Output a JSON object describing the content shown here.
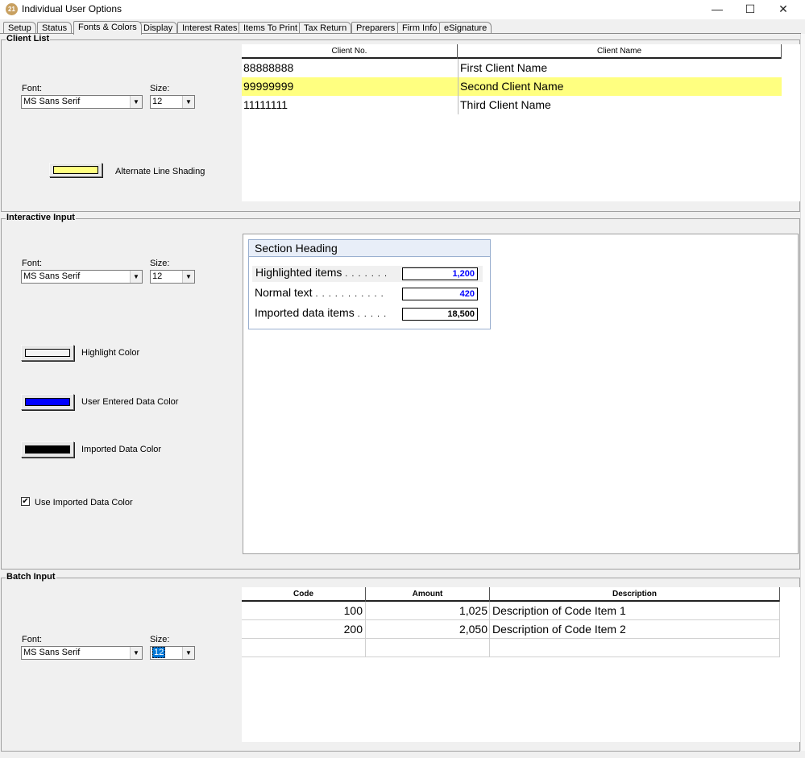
{
  "window": {
    "title": "Individual User Options",
    "icon_text": "21",
    "minimize": "—",
    "maximize": "☐",
    "close": "✕"
  },
  "tabs": [
    {
      "label": "Setup"
    },
    {
      "label": "Status"
    },
    {
      "label": "Fonts & Colors"
    },
    {
      "label": "Display"
    },
    {
      "label": "Interest Rates"
    },
    {
      "label": "Items To Print"
    },
    {
      "label": "Tax Return"
    },
    {
      "label": "Preparers"
    },
    {
      "label": "Firm Info"
    },
    {
      "label": "eSignature"
    }
  ],
  "client_list": {
    "label": "Client List",
    "font_label": "Font:",
    "font_value": "MS Sans Serif",
    "size_label": "Size:",
    "size_value": "12",
    "shading_label": "Alternate Line Shading",
    "shading_color": "#ffff80",
    "columns": [
      "Client No.",
      "Client Name"
    ],
    "rows": [
      {
        "no": "88888888",
        "name": "First Client Name"
      },
      {
        "no": "99999999",
        "name": "Second Client Name"
      },
      {
        "no": "11111111",
        "name": "Third Client Name"
      }
    ]
  },
  "interactive_input": {
    "label": "Interactive Input",
    "font_label": "Font:",
    "font_value": "MS Sans Serif",
    "size_label": "Size:",
    "size_value": "12",
    "highlight_label": "Highlight Color",
    "highlight_color": "#f4f4f4",
    "user_label": "User Entered Data Color",
    "user_color": "#0000ff",
    "imported_label": "Imported Data Color",
    "imported_color": "#000000",
    "use_imported_label": "Use Imported Data Color",
    "use_imported_checked": "✔",
    "preview": {
      "heading": "Section Heading",
      "items": [
        {
          "label": "Highlighted items",
          "dots": ". . . . . . .",
          "value": "1,200"
        },
        {
          "label": "Normal text",
          "dots": ". . . . . . . . . . .",
          "value": "420"
        },
        {
          "label": "Imported data items",
          "dots": ". . . . .",
          "value": "18,500"
        }
      ]
    }
  },
  "batch_input": {
    "label": "Batch Input",
    "font_label": "Font:",
    "font_value": "MS Sans Serif",
    "size_label": "Size:",
    "size_value": "12",
    "columns": [
      "Code",
      "Amount",
      "Description"
    ],
    "rows": [
      {
        "code": "100",
        "amount": "1,025",
        "description": "Description of Code Item 1"
      },
      {
        "code": "200",
        "amount": "2,050",
        "description": "Description of Code Item 2"
      }
    ]
  }
}
